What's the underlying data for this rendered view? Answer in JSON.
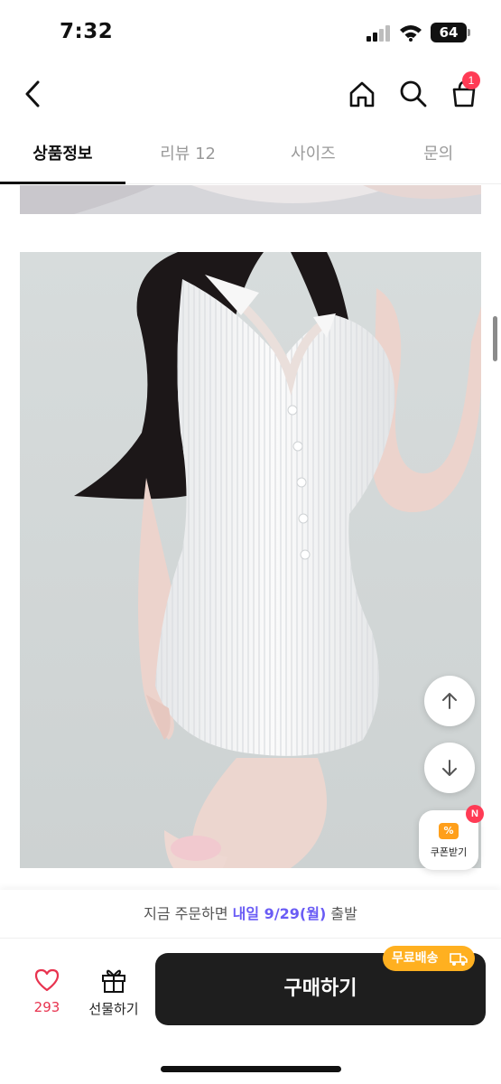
{
  "status_bar": {
    "time": "7:32",
    "battery": "64"
  },
  "header": {
    "cart_count": "1"
  },
  "tabs": [
    {
      "label": "상품정보",
      "active": true
    },
    {
      "label": "리뷰 12",
      "active": false
    },
    {
      "label": "사이즈",
      "active": false
    },
    {
      "label": "문의",
      "active": false
    }
  ],
  "coupon": {
    "label": "쿠폰받기",
    "icon_text": "%",
    "new_badge": "N"
  },
  "shipping": {
    "prefix": "지금 주문하면 ",
    "highlight": "내일 9/29(월)",
    "suffix": " 출발"
  },
  "actions": {
    "like_count": "293",
    "gift_label": "선물하기",
    "buy_label": "구매하기",
    "free_shipping_label": "무료배송"
  },
  "colors": {
    "accent": "#6a5cf5",
    "badge": "#ff3b55",
    "like": "#e8334f",
    "free_ship": "#ffb020",
    "buy_bg": "#1e1e1e"
  },
  "icons": [
    "back-icon",
    "home-icon",
    "search-icon",
    "cart-icon",
    "arrow-up-icon",
    "arrow-down-icon",
    "coupon-icon",
    "heart-icon",
    "gift-icon",
    "truck-icon"
  ]
}
